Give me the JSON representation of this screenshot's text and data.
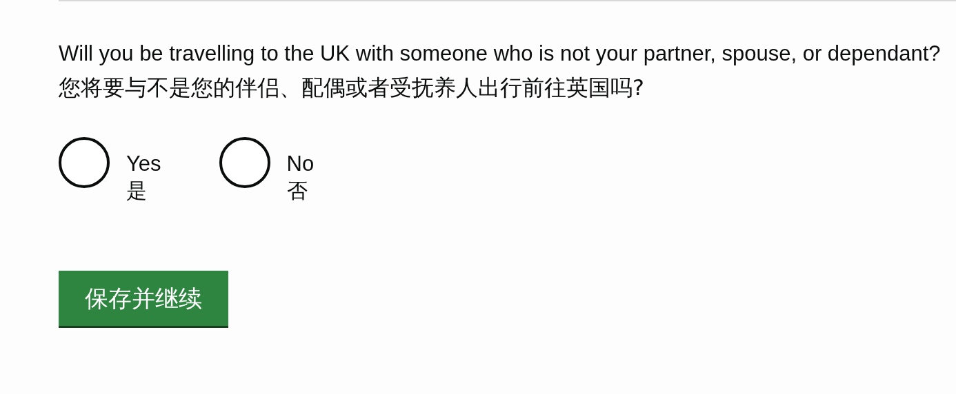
{
  "question": {
    "english": "Will you be travelling to the UK with someone who is not your partner, spouse, or dependant?",
    "chinese": "您将要与不是您的伴侣、配偶或者受抚养人出行前往英国吗?"
  },
  "options": [
    {
      "label": "Yes",
      "translation": "是",
      "selected": false
    },
    {
      "label": "No",
      "translation": "否",
      "selected": false
    }
  ],
  "button": {
    "label": "保存并继续"
  }
}
